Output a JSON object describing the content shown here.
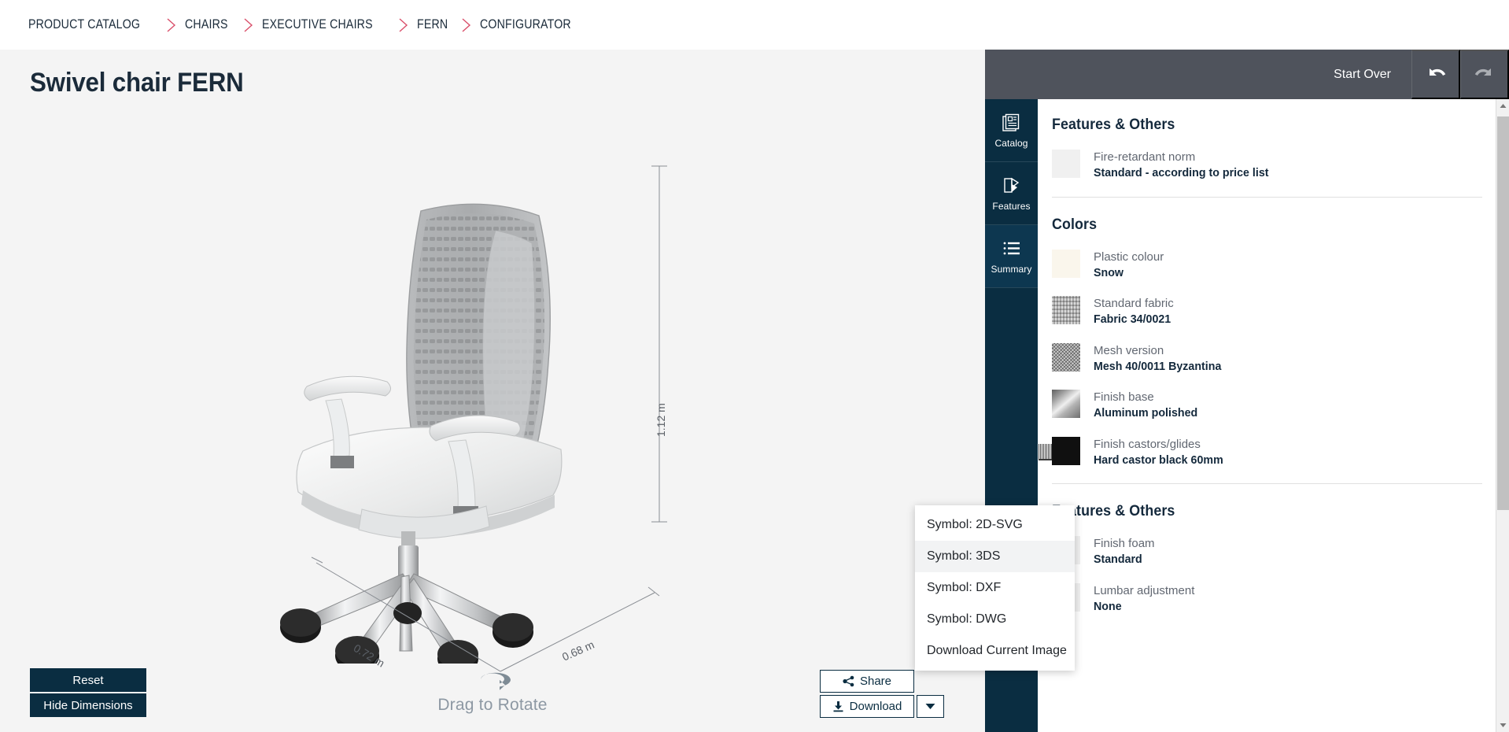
{
  "breadcrumb": {
    "items": [
      {
        "label": "PRODUCT CATALOG"
      },
      {
        "label": "CHAIRS"
      },
      {
        "label": "EXECUTIVE CHAIRS"
      },
      {
        "label": "FERN"
      },
      {
        "label": "CONFIGURATOR"
      }
    ],
    "separator_color": "#d94f6a"
  },
  "viewer": {
    "title": "Swivel chair FERN",
    "rotate_hint": "Drag to Rotate",
    "dimensions": {
      "height": "1.12 m",
      "width": "0.72 m",
      "depth": "0.68 m"
    },
    "buttons": {
      "reset": "Reset",
      "hide_dimensions": "Hide Dimensions"
    }
  },
  "topbar": {
    "start_over": "Start Over",
    "undo_icon": "undo-arrow-icon",
    "redo_icon": "redo-arrow-icon"
  },
  "tabs": [
    {
      "label": "Catalog",
      "icon": "catalog-pages-icon",
      "active": false
    },
    {
      "label": "Features",
      "icon": "swatch-fan-icon",
      "active": false
    },
    {
      "label": "Summary",
      "icon": "list-bullets-icon",
      "active": true
    }
  ],
  "panel": {
    "sections": [
      {
        "title": "Features & Others",
        "options": [
          {
            "label": "Fire-retardant norm",
            "value": "Standard - according to price list",
            "swatch": "plain"
          }
        ]
      },
      {
        "title": "Colors",
        "options": [
          {
            "label": "Plastic colour",
            "value": "Snow",
            "swatch": "snow"
          },
          {
            "label": "Standard fabric",
            "value": "Fabric 34/0021",
            "swatch": "fabric"
          },
          {
            "label": "Mesh version",
            "value": "Mesh 40/0011 Byzantina",
            "swatch": "mesh"
          },
          {
            "label": "Finish base",
            "value": "Aluminum polished",
            "swatch": "alu"
          },
          {
            "label": "Finish castors/glides",
            "value": "Hard castor black 60mm",
            "swatch": "castor"
          }
        ]
      },
      {
        "title": "Features & Others",
        "options": [
          {
            "label": "Finish foam",
            "value": "Standard",
            "swatch": "plain"
          },
          {
            "label": "Lumbar adjustment",
            "value": "None",
            "swatch": "plain"
          }
        ]
      }
    ]
  },
  "actions": {
    "share": "Share",
    "download": "Download",
    "share_icon": "share-nodes-icon",
    "download_icon": "download-arrow-icon",
    "caret_icon": "caret-down-icon"
  },
  "dropdown": {
    "items": [
      {
        "label": "Symbol: 2D-SVG",
        "highlighted": false
      },
      {
        "label": "Symbol: 3DS",
        "highlighted": true
      },
      {
        "label": "Symbol: DXF",
        "highlighted": false
      },
      {
        "label": "Symbol: DWG",
        "highlighted": false
      },
      {
        "label": "Download Current Image",
        "highlighted": false
      }
    ]
  },
  "colors": {
    "navy": "#0a2d41",
    "topbar_gray": "#4f535c",
    "viewer_bg": "#f4f4f4",
    "accent_red": "#d94f6a",
    "text_dark": "#14293c",
    "text_muted": "#616771"
  }
}
